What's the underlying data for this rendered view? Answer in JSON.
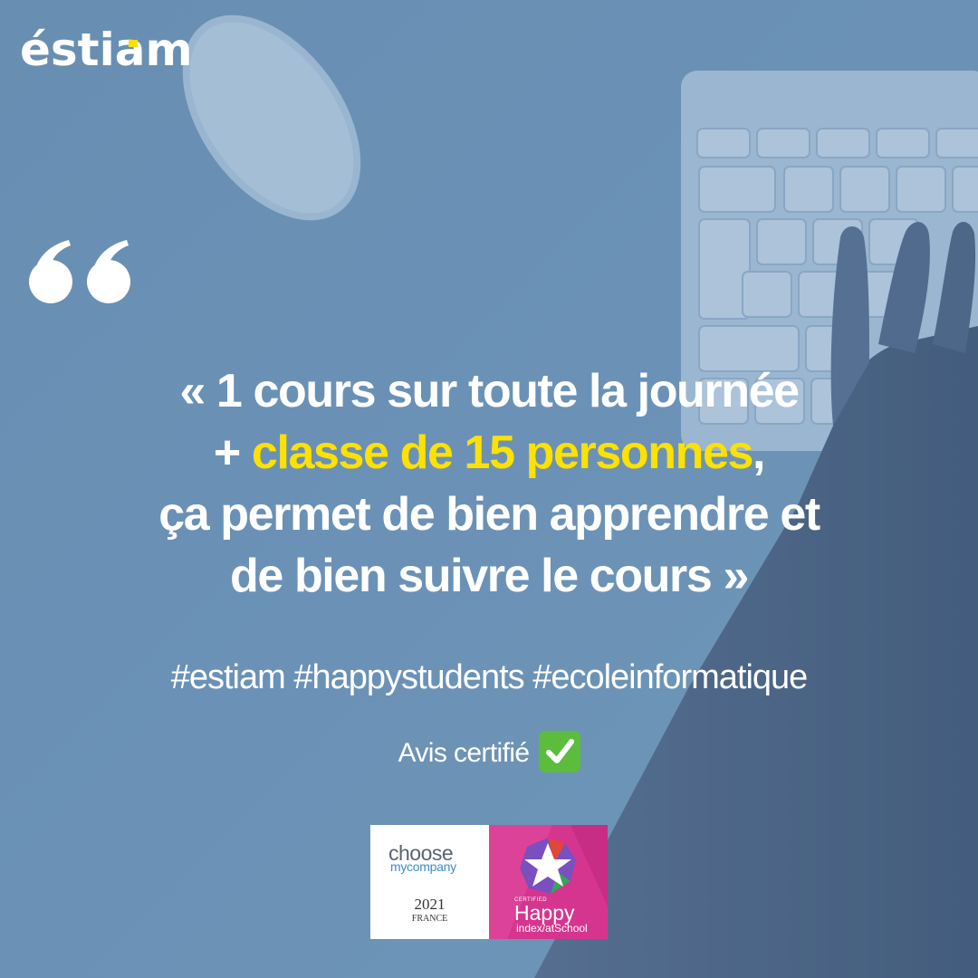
{
  "brand": {
    "logo_text": "éstiam"
  },
  "quote": {
    "open_mark": "«",
    "line1": "1 cours sur toute la journée",
    "line2_prefix": "+ ",
    "line2_highlight": "classe de 15 personnes",
    "line2_suffix": ",",
    "line3": "ça permet de bien apprendre et",
    "line4": "de bien suivre le cours",
    "close_mark": "»"
  },
  "hashtags": "#estiam #happystudents #ecoleinformatique",
  "verified": {
    "label": "Avis certifié",
    "icon": "check-mark-icon"
  },
  "badges": {
    "choose_my_company": {
      "choose": "choose",
      "my_company": "mycompany",
      "year": "2021",
      "country": "FRANCE"
    },
    "happy_index": {
      "certified": "CERTIFIED",
      "happy": "Happy",
      "index": "index/atSchool"
    }
  },
  "colors": {
    "background": "#6f95b8",
    "highlight": "#ffe100",
    "logo_dot": "#ffe100",
    "check_bg": "#5bbd3b",
    "badge_pink": "#d6358f"
  }
}
